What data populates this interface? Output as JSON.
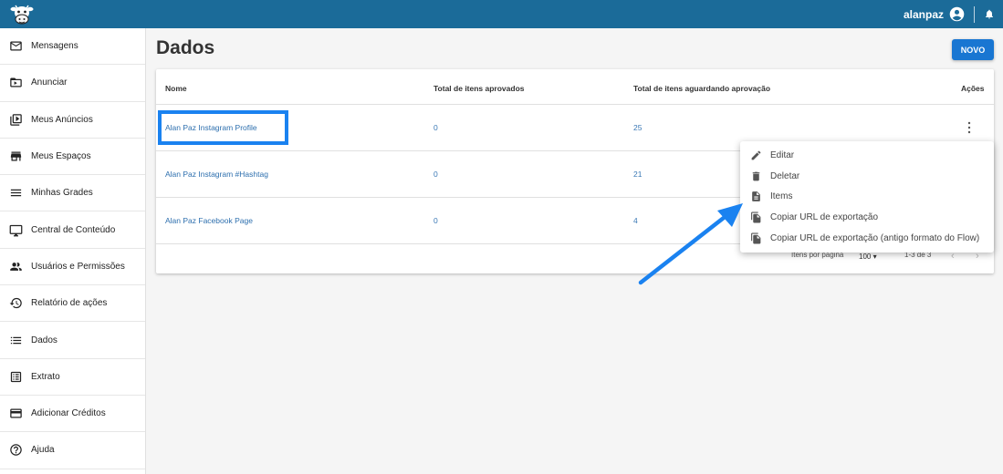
{
  "header": {
    "username": "alanpaz"
  },
  "sidebar": {
    "items": [
      {
        "label": "Mensagens"
      },
      {
        "label": "Anunciar"
      },
      {
        "label": "Meus Anúncios"
      },
      {
        "label": "Meus Espaços"
      },
      {
        "label": "Minhas Grades"
      },
      {
        "label": "Central de Conteúdo"
      },
      {
        "label": "Usuários e Permissões"
      },
      {
        "label": "Relatório de ações"
      },
      {
        "label": "Dados"
      },
      {
        "label": "Extrato"
      },
      {
        "label": "Adicionar Créditos"
      },
      {
        "label": "Ajuda"
      }
    ]
  },
  "main": {
    "title": "Dados",
    "new_button": "NOVO",
    "table": {
      "columns": [
        "Nome",
        "Total de itens aprovados",
        "Total de itens aguardando aprovação",
        "Ações"
      ],
      "rows": [
        {
          "name": "Alan Paz Instagram Profile",
          "approved": "0",
          "pending": "25"
        },
        {
          "name": "Alan Paz Instagram #Hashtag",
          "approved": "0",
          "pending": "21"
        },
        {
          "name": "Alan Paz Facebook Page",
          "approved": "0",
          "pending": "4"
        }
      ],
      "pagination": {
        "per_page_label": "Itens por página",
        "per_page_value": "100",
        "range": "1-3 de 3"
      }
    },
    "row_menu": {
      "items": [
        {
          "label": "Editar",
          "icon": "pencil-icon"
        },
        {
          "label": "Deletar",
          "icon": "trash-icon"
        },
        {
          "label": "Items",
          "icon": "document-icon"
        },
        {
          "label": "Copiar URL de exportação",
          "icon": "copy-icon"
        },
        {
          "label": "Copiar URL de exportação (antigo formato do Flow)",
          "icon": "copy-icon"
        }
      ]
    }
  },
  "colors": {
    "topbar": "#1b6b99",
    "primary_button": "#1976d2",
    "link": "#2d6fae",
    "annotation": "#1a82f0"
  }
}
